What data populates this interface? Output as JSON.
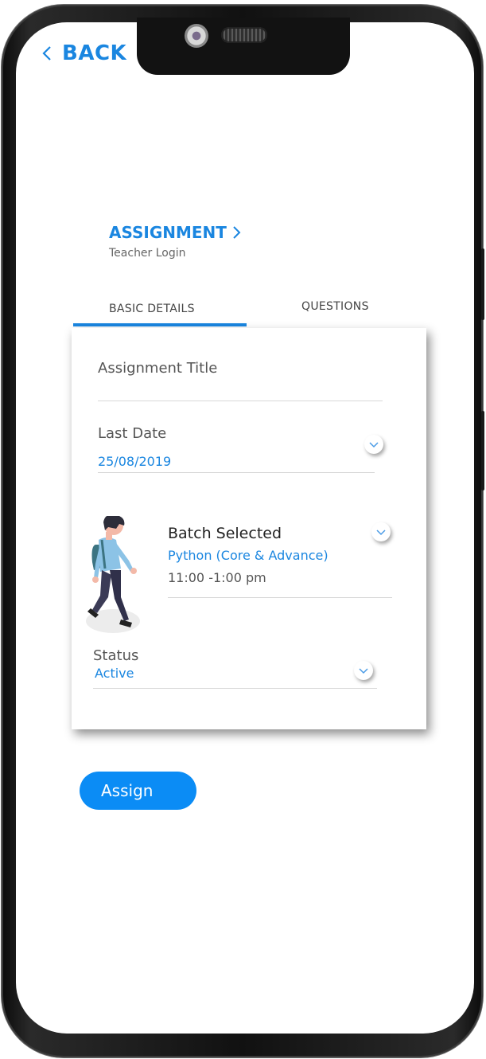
{
  "nav": {
    "back_label": "BACK"
  },
  "header": {
    "title": "ASSIGNMENT",
    "subtitle": "Teacher Login"
  },
  "tabs": [
    {
      "label": "BASIC DETAILS",
      "active": true
    },
    {
      "label": "QUESTIONS",
      "active": false
    }
  ],
  "form": {
    "assignment_title": {
      "label": "Assignment Title",
      "value": ""
    },
    "last_date": {
      "label": "Last Date",
      "value": "25/08/2019"
    },
    "batch": {
      "label": "Batch Selected",
      "course": "Python (Core & Advance)",
      "time": "11:00 -1:00 pm"
    },
    "status": {
      "label": "Status",
      "value": "Active"
    }
  },
  "actions": {
    "assign_label": "Assign"
  },
  "colors": {
    "accent": "#1a86e0",
    "button": "#0b8cf5"
  }
}
